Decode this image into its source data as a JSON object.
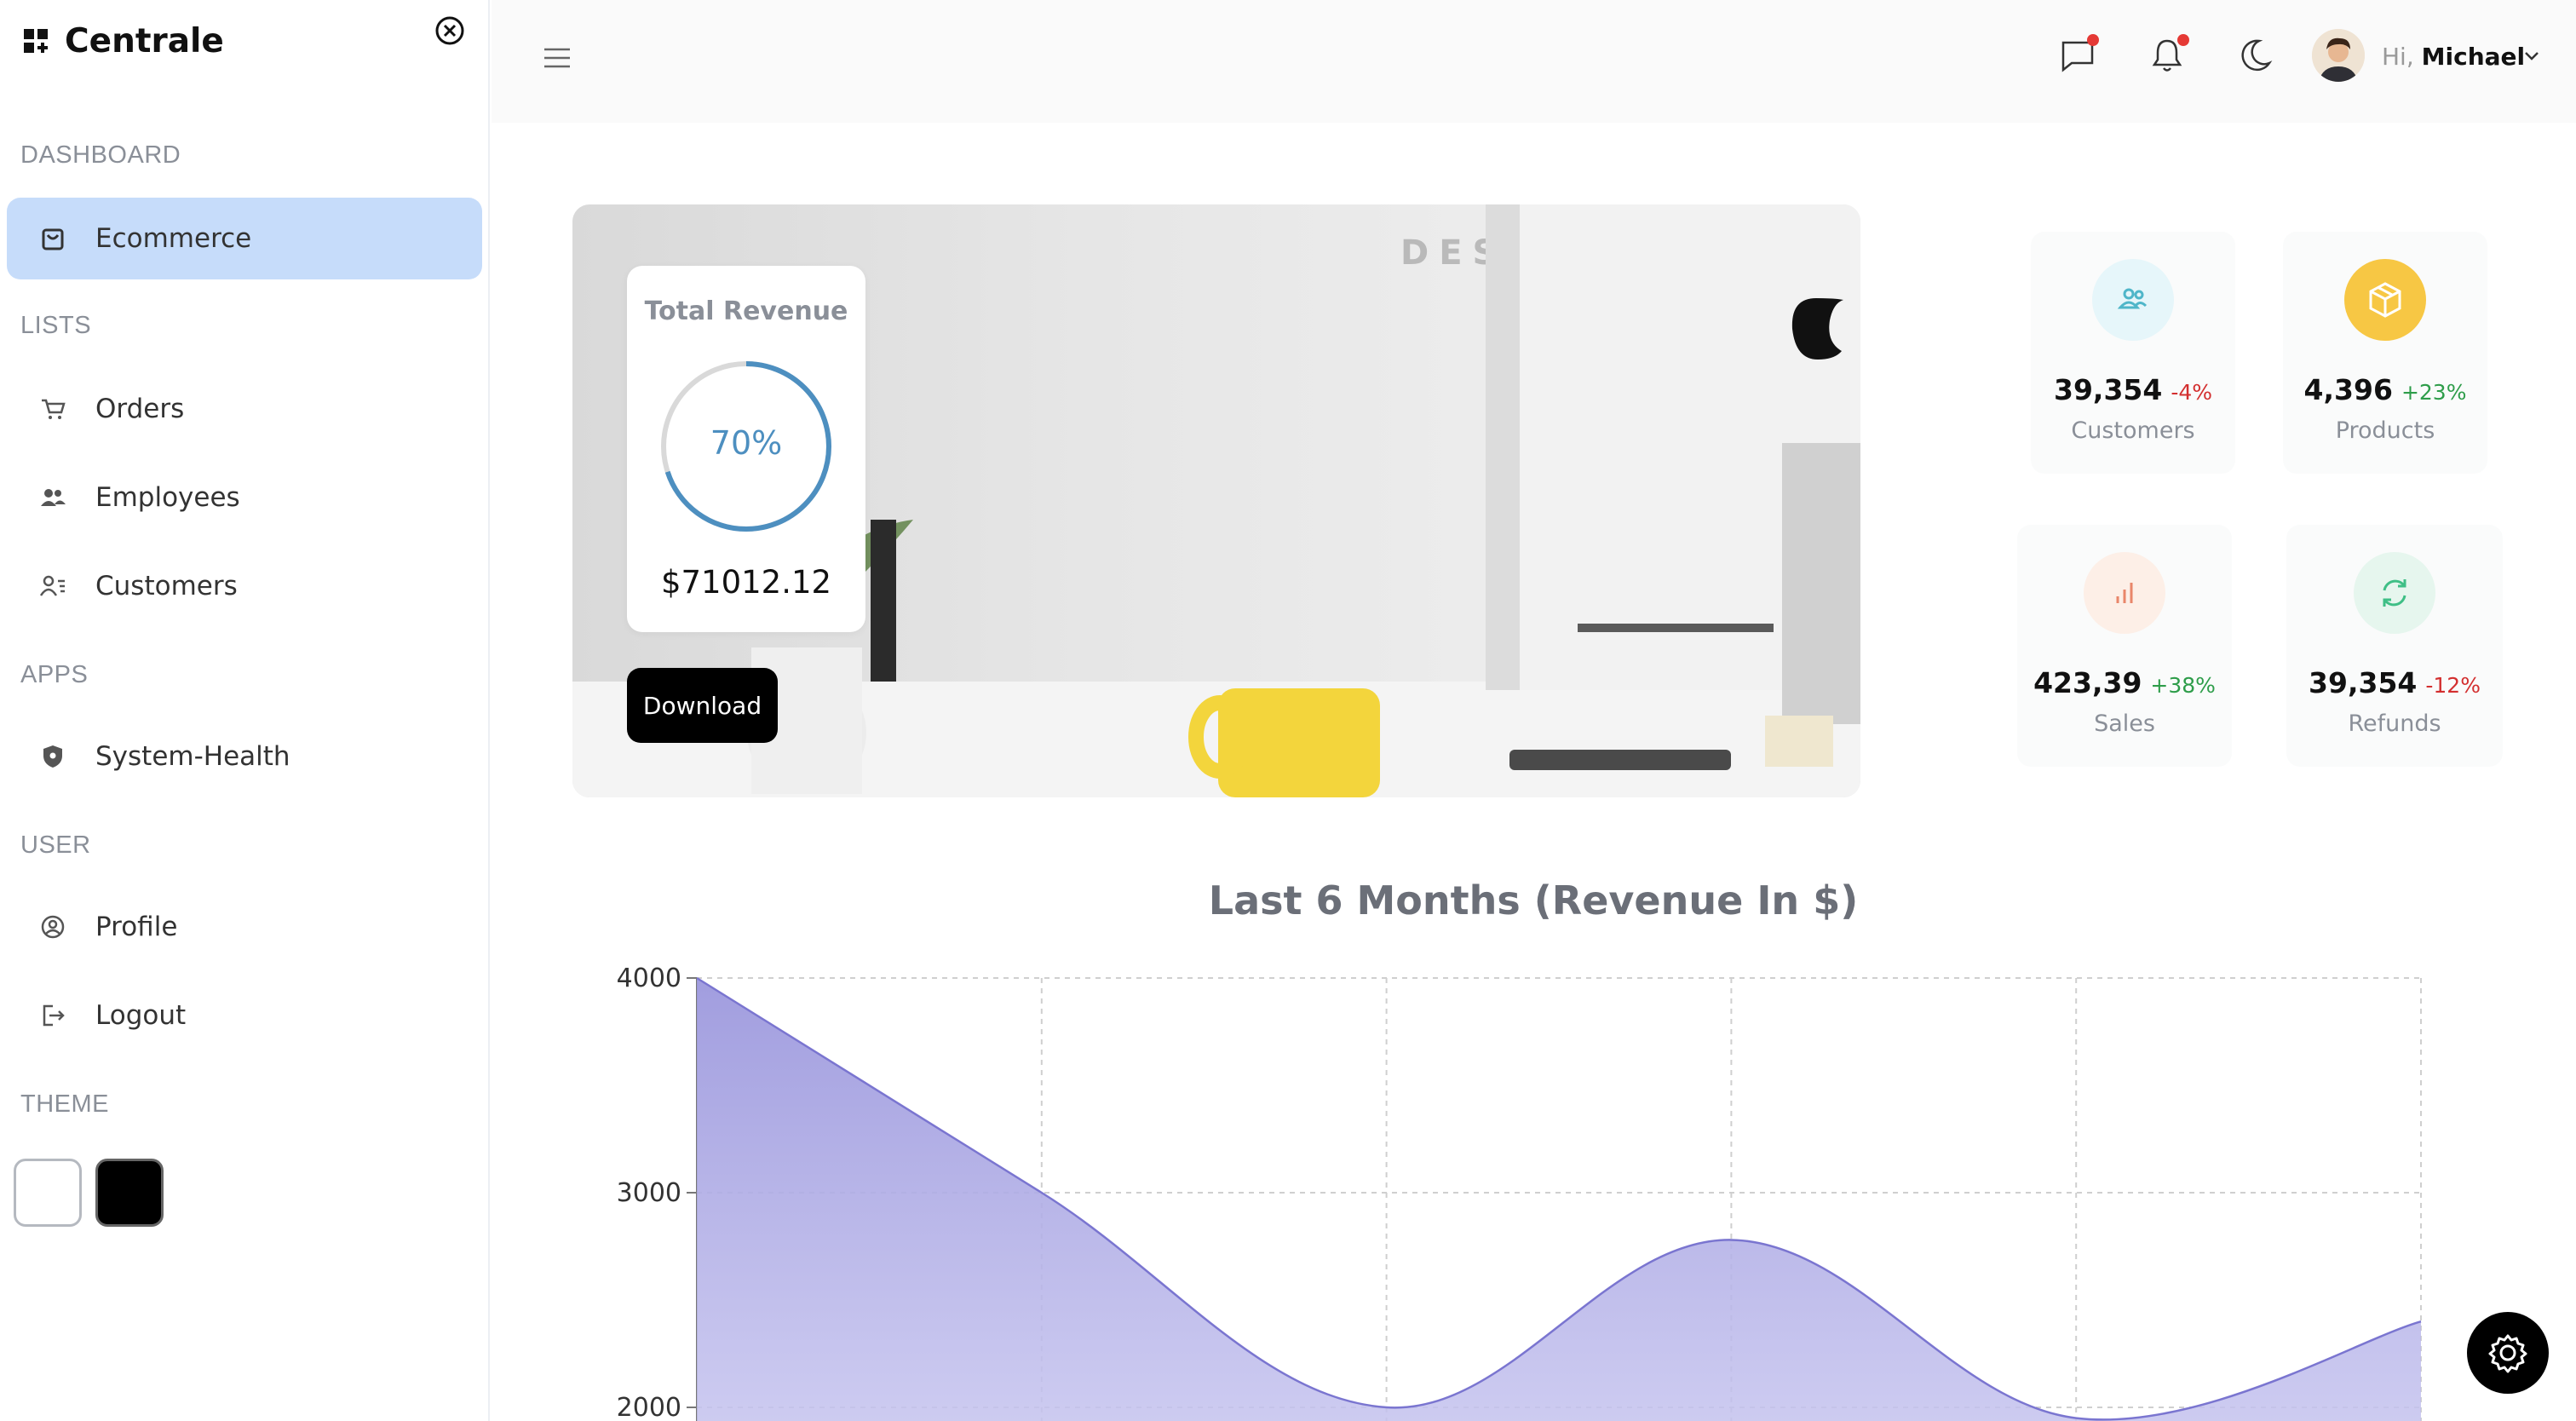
{
  "brand": {
    "name": "Centrale"
  },
  "sidebar": {
    "sections": [
      {
        "title": "DASHBOARD"
      },
      {
        "title": "LISTS"
      },
      {
        "title": "APPS"
      },
      {
        "title": "USER"
      },
      {
        "title": "THEME"
      }
    ],
    "items": [
      {
        "label": "Ecommerce",
        "icon": "shopping-bag-icon",
        "active": true
      },
      {
        "label": "Orders",
        "icon": "cart-icon"
      },
      {
        "label": "Employees",
        "icon": "users-icon"
      },
      {
        "label": "Customers",
        "icon": "user-list-icon"
      },
      {
        "label": "System-Health",
        "icon": "shield-icon"
      },
      {
        "label": "Profile",
        "icon": "user-circle-icon"
      },
      {
        "label": "Logout",
        "icon": "logout-icon"
      }
    ],
    "theme_options": [
      "light",
      "dark"
    ]
  },
  "header": {
    "greeting_prefix": "Hi,",
    "user_name": "Michael"
  },
  "revenue": {
    "title": "Total Revenue",
    "percent": "70%",
    "percent_value": 0.7,
    "amount": "$71012.12",
    "download_label": "Download"
  },
  "stats": [
    {
      "value": "39,354",
      "change": "-4%",
      "label": "Customers",
      "color": "#4fb6c9",
      "bg": "#e6f6fa"
    },
    {
      "value": "4,396",
      "change": "+23%",
      "label": "Products",
      "color": "#ffffff",
      "bg": "#f7c744"
    },
    {
      "value": "423,39",
      "change": "+38%",
      "label": "Sales",
      "color": "#e9866a",
      "bg": "#fdefe7"
    },
    {
      "value": "39,354",
      "change": "-12%",
      "label": "Refunds",
      "color": "#3fbf86",
      "bg": "#e6f6ee"
    }
  ],
  "colors": {
    "negative": "#d32f2f",
    "positive": "#2e9d4a",
    "accent": "#c6dcfa",
    "chart_fill": "#9c98dd",
    "chart_line": "#7a75d0"
  },
  "chart_data": {
    "type": "area",
    "title": "Last 6 Months (Revenue In $)",
    "y_ticks": [
      "4000",
      "3000",
      "2000"
    ],
    "values": [
      4000,
      3000,
      2000,
      2780,
      1950,
      2400
    ],
    "ylim": [
      1500,
      4000
    ],
    "grid": true
  }
}
